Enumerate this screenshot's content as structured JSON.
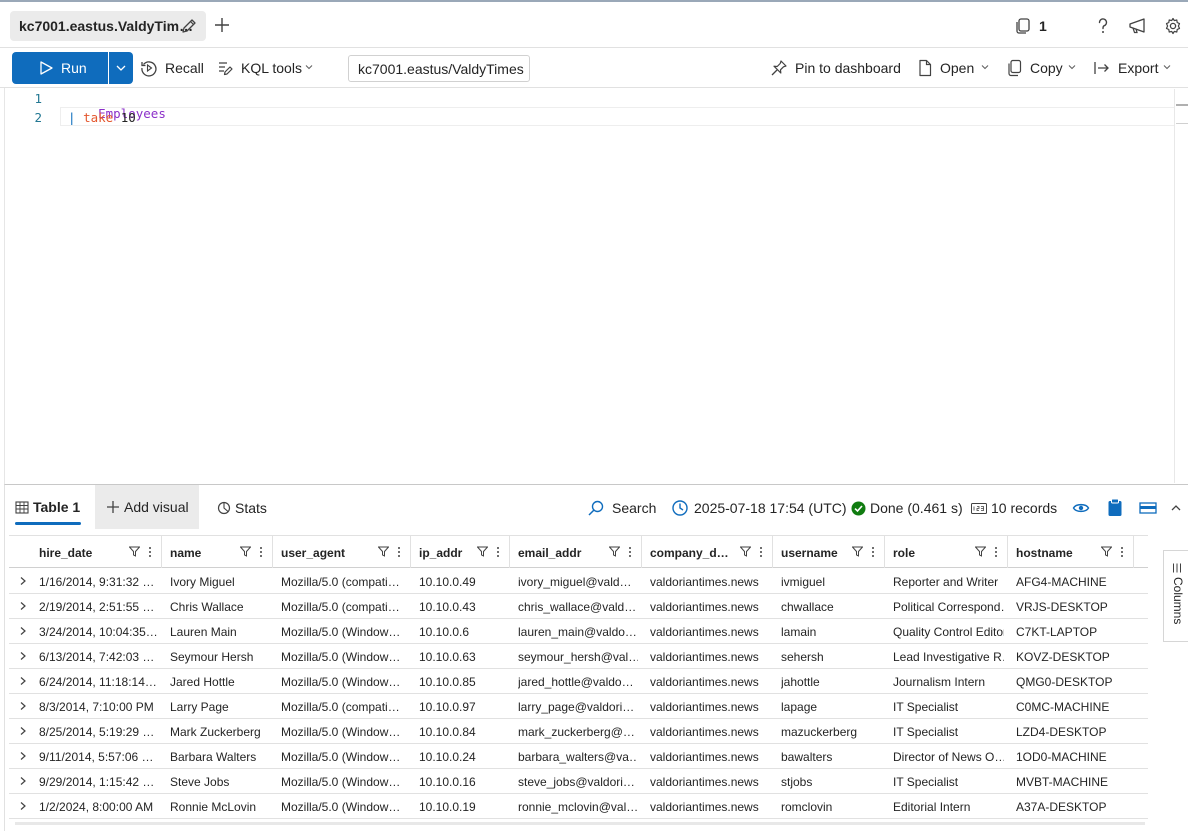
{
  "tabs": {
    "active_label": "kc7001.eastus.ValdyTim…",
    "new_tab_symbol": "+",
    "icons": {
      "edit": "pencil-icon",
      "new": "plus-icon"
    }
  },
  "topright": {
    "copies_count": "1",
    "icons": [
      "copy-stack-icon",
      "help-icon",
      "feedback-megaphone-icon",
      "settings-gear-icon"
    ]
  },
  "toolbar": {
    "run_label": "Run",
    "recall_label": "Recall",
    "kql_tools_label": "KQL tools",
    "connection": "kc7001.eastus/ValdyTimes",
    "pin_label": "Pin to dashboard",
    "open_label": "Open",
    "copy_label": "Copy",
    "export_label": "Export"
  },
  "editor": {
    "lines": [
      {
        "number": "1",
        "segments": [
          {
            "text": "Employees",
            "color": "#8b2fc9"
          }
        ]
      },
      {
        "number": "2",
        "segments": [
          {
            "text": "| ",
            "color": "#0b6cbd"
          },
          {
            "text": "take",
            "color": "#e4572e"
          },
          {
            "text": " 10",
            "color": "#242424"
          }
        ]
      }
    ]
  },
  "results": {
    "table_tab": "Table 1",
    "add_visual": "Add visual",
    "stats": "Stats",
    "search": "Search",
    "timestamp": "2025-07-18 17:54 (UTC)",
    "status": "Done (0.461 s)",
    "records": "10 records",
    "columns_panel": "Columns",
    "status_color": "#107c10",
    "accent": "#0f6cbd"
  },
  "table": {
    "columns": [
      "hire_date",
      "name",
      "user_agent",
      "ip_addr",
      "email_addr",
      "company_d…",
      "username",
      "role",
      "hostname"
    ],
    "rows": [
      [
        "1/16/2014, 9:31:32 …",
        "Ivory Miguel",
        "Mozilla/5.0 (compati…",
        "10.10.0.49",
        "ivory_miguel@vald…",
        "valdoriantimes.news",
        "ivmiguel",
        "Reporter and Writer",
        "AFG4-MACHINE"
      ],
      [
        "2/19/2014, 2:51:55 …",
        "Chris Wallace",
        "Mozilla/5.0 (compati…",
        "10.10.0.43",
        "chris_wallace@vald…",
        "valdoriantimes.news",
        "chwallace",
        "Political Correspond…",
        "VRJS-DESKTOP"
      ],
      [
        "3/24/2014, 10:04:35…",
        "Lauren Main",
        "Mozilla/5.0 (Window…",
        "10.10.0.6",
        "lauren_main@valdo…",
        "valdoriantimes.news",
        "lamain",
        "Quality Control Editor",
        "C7KT-LAPTOP"
      ],
      [
        "6/13/2014, 7:42:03 …",
        "Seymour Hersh",
        "Mozilla/5.0 (Window…",
        "10.10.0.63",
        "seymour_hersh@val…",
        "valdoriantimes.news",
        "sehersh",
        "Lead Investigative R…",
        "KOVZ-DESKTOP"
      ],
      [
        "6/24/2014, 11:18:14…",
        "Jared Hottle",
        "Mozilla/5.0 (Window…",
        "10.10.0.85",
        "jared_hottle@valdo…",
        "valdoriantimes.news",
        "jahottle",
        "Journalism Intern",
        "QMG0-DESKTOP"
      ],
      [
        "8/3/2014, 7:10:00 PM",
        "Larry Page",
        "Mozilla/5.0 (compati…",
        "10.10.0.97",
        "larry_page@valdori…",
        "valdoriantimes.news",
        "lapage",
        "IT Specialist",
        "C0MC-MACHINE"
      ],
      [
        "8/25/2014, 5:19:29 …",
        "Mark Zuckerberg",
        "Mozilla/5.0 (Window…",
        "10.10.0.84",
        "mark_zuckerberg@…",
        "valdoriantimes.news",
        "mazuckerberg",
        "IT Specialist",
        "LZD4-DESKTOP"
      ],
      [
        "9/11/2014, 5:57:06 …",
        "Barbara Walters",
        "Mozilla/5.0 (Window…",
        "10.10.0.24",
        "barbara_walters@va…",
        "valdoriantimes.news",
        "bawalters",
        "Director of News O…",
        "1OD0-MACHINE"
      ],
      [
        "9/29/2014, 1:15:42 …",
        "Steve Jobs",
        "Mozilla/5.0 (Window…",
        "10.10.0.16",
        "steve_jobs@valdori…",
        "valdoriantimes.news",
        "stjobs",
        "IT Specialist",
        "MVBT-MACHINE"
      ],
      [
        "1/2/2024, 8:00:00 AM",
        "Ronnie McLovin",
        "Mozilla/5.0 (Window…",
        "10.10.0.19",
        "ronnie_mclovin@val…",
        "valdoriantimes.news",
        "romclovin",
        "Editorial Intern",
        "A37A-DESKTOP"
      ]
    ]
  }
}
